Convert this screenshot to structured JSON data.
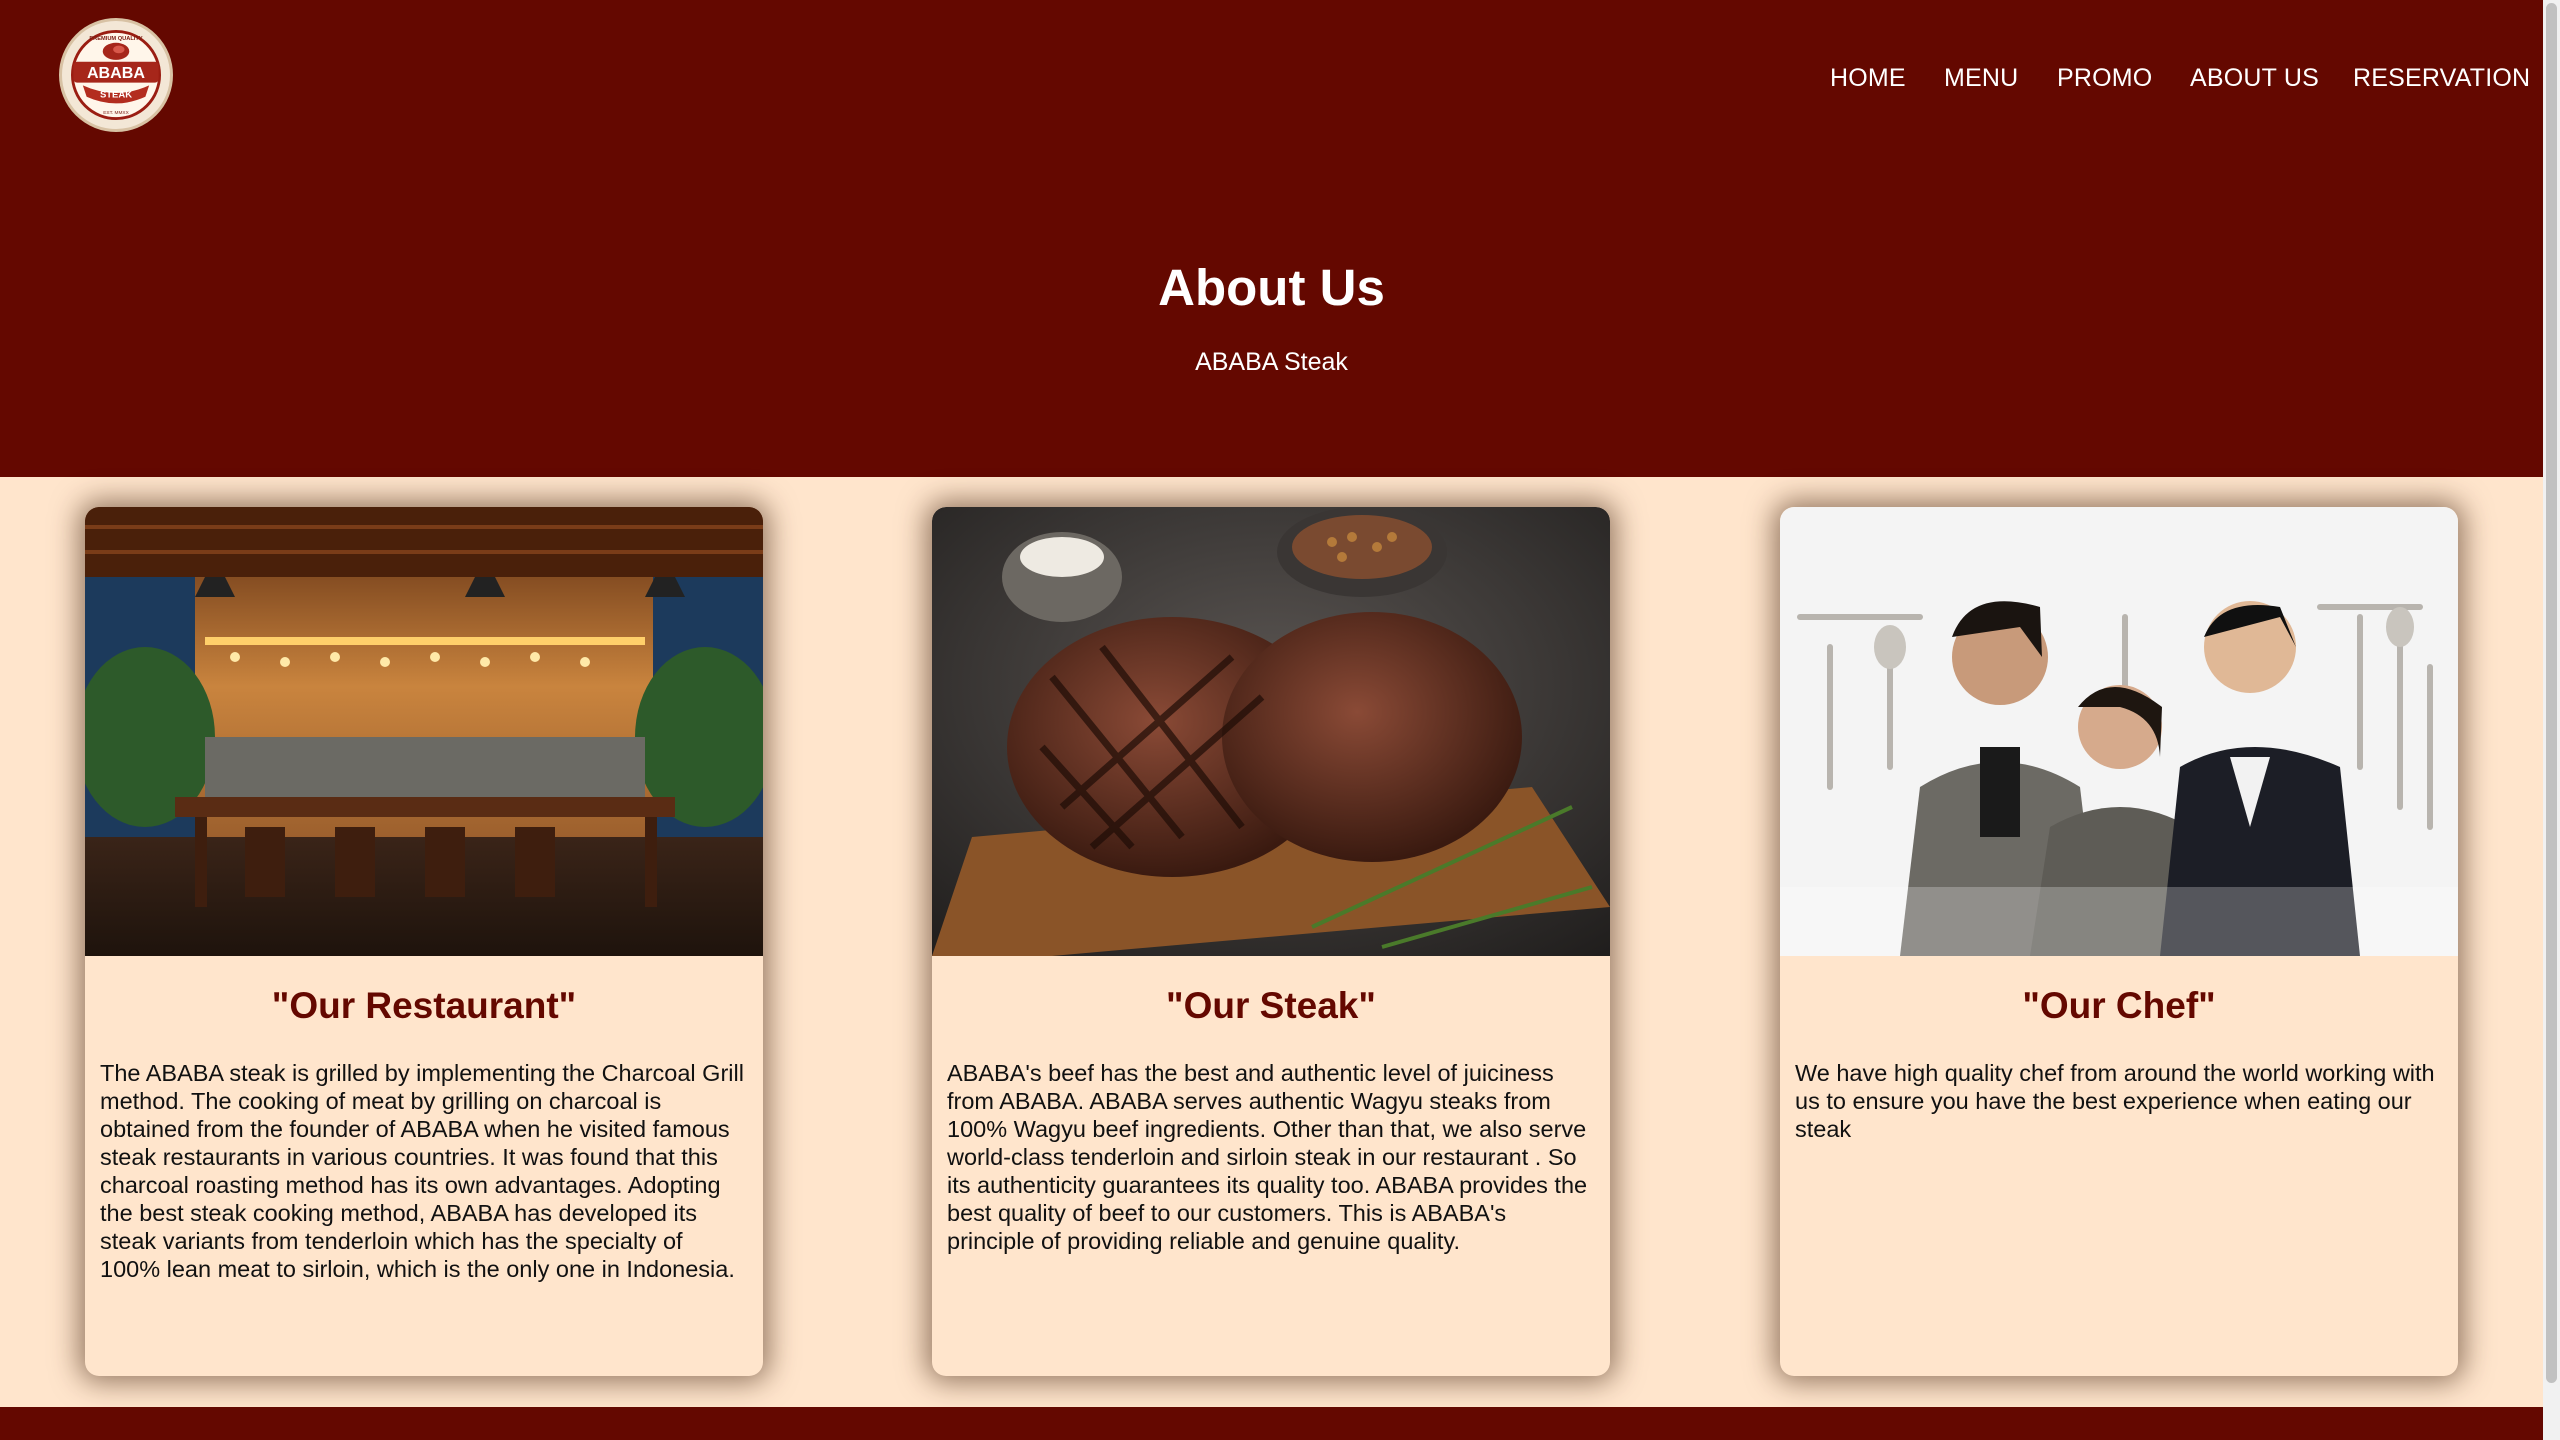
{
  "brand": {
    "logo_text": "ABABA",
    "logo_subtext": "STEAK",
    "logo_top": "PREMIUM QUALITY",
    "logo_bottom": "EST. MMXX"
  },
  "nav": {
    "items": [
      {
        "label": "HOME"
      },
      {
        "label": "MENU"
      },
      {
        "label": "PROMO"
      },
      {
        "label": "ABOUT US"
      },
      {
        "label": "RESERVATION"
      }
    ]
  },
  "hero": {
    "title": "About Us",
    "subtitle": "ABABA Steak"
  },
  "cards": [
    {
      "title": "\"Our Restaurant\"",
      "image": "restaurant-interior-photo",
      "text": "The ABABA steak is grilled by implementing the Charcoal Grill method. The cooking of meat by grilling on charcoal is obtained from the founder of ABABA when he visited famous steak restaurants in various countries. It was found that this charcoal roasting method has its own advantages. Adopting the best steak cooking method, ABABA has developed its steak variants from tenderloin which has the specialty of 100% lean meat to sirloin, which is the only one in Indonesia."
    },
    {
      "title": "\"Our Steak\"",
      "image": "grilled-steak-photo",
      "text": "ABABA's beef has the best and authentic level of juiciness from ABABA. ABABA serves authentic Wagyu steaks from 100% Wagyu beef ingredients. Other than that, we also serve world-class tenderloin and sirloin steak in our restaurant . So its authenticity guarantees its quality too. ABABA provides the best quality of beef to our customers. This is ABABA's principle of providing reliable and genuine quality."
    },
    {
      "title": "\"Our Chef\"",
      "image": "chef-team-photo",
      "text": "We have high quality chef from around the world working with us to ensure you have the best experience when eating our steak"
    }
  ],
  "colors": {
    "primary": "#640800",
    "background": "#ffe5cc",
    "text": "#111111"
  }
}
